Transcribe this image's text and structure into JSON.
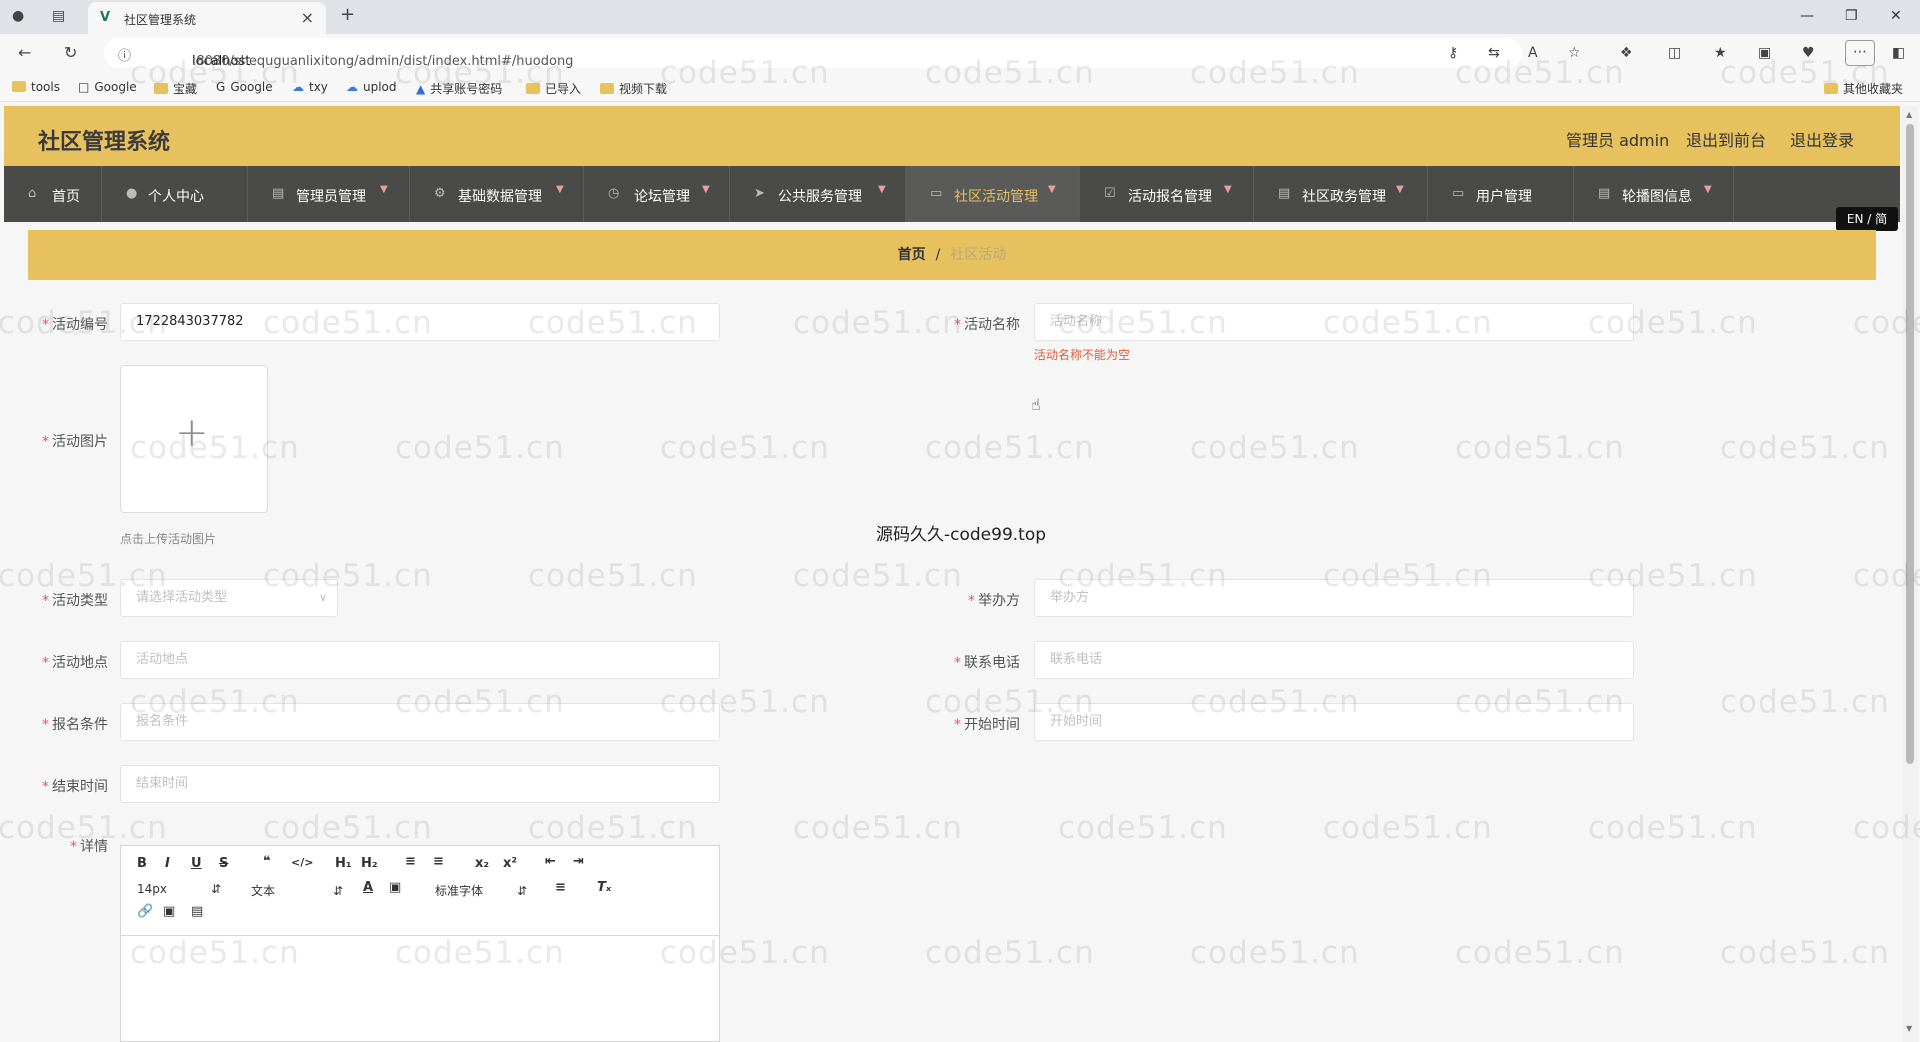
{
  "browser": {
    "tab_title": "社区管理系统",
    "url_host": "localhost",
    "url_rest": ":8080/shequguanlixitong/admin/dist/index.html#/huodong",
    "bookmarks": [
      "tools",
      "Google",
      "宝藏",
      "Google",
      "txy",
      "uplod",
      "共享账号密码",
      "已导入",
      "视频下载"
    ],
    "other_bookmarks": "其他收藏夹"
  },
  "header": {
    "title": "社区管理系统",
    "user": "管理员 admin",
    "to_front": "退出到前台",
    "logout": "退出登录"
  },
  "nav": [
    {
      "label": "首页",
      "icon": "home-icon"
    },
    {
      "label": "个人中心",
      "icon": "user-icon"
    },
    {
      "label": "管理员管理",
      "icon": "doc-icon"
    },
    {
      "label": "基础数据管理",
      "icon": "gear-icon"
    },
    {
      "label": "论坛管理",
      "icon": "clock-icon"
    },
    {
      "label": "公共服务管理",
      "icon": "send-icon"
    },
    {
      "label": "社区活动管理",
      "icon": "card-icon"
    },
    {
      "label": "活动报名管理",
      "icon": "check-icon"
    },
    {
      "label": "社区政务管理",
      "icon": "doc-icon"
    },
    {
      "label": "用户管理",
      "icon": "monitor-icon"
    },
    {
      "label": "轮播图信息",
      "icon": "image-icon"
    }
  ],
  "lang_switch": "EN / 简",
  "breadcrumb": {
    "home": "首页",
    "sep": "/",
    "current": "社区活动"
  },
  "form": {
    "activity_no": {
      "label": "活动编号",
      "value": "1722843037782"
    },
    "activity_name": {
      "label": "活动名称",
      "placeholder": "活动名称",
      "error": "活动名称不能为空"
    },
    "activity_image": {
      "label": "活动图片",
      "hint": "点击上传活动图片"
    },
    "activity_type": {
      "label": "活动类型",
      "placeholder": "请选择活动类型"
    },
    "organizer": {
      "label": "举办方",
      "placeholder": "举办方"
    },
    "location": {
      "label": "活动地点",
      "placeholder": "活动地点"
    },
    "phone": {
      "label": "联系电话",
      "placeholder": "联系电话"
    },
    "requirement": {
      "label": "报名条件",
      "placeholder": "报名条件"
    },
    "start_time": {
      "label": "开始时间",
      "placeholder": "开始时间"
    },
    "end_time": {
      "label": "结束时间",
      "placeholder": "结束时间"
    },
    "details": {
      "label": "详情"
    }
  },
  "editor": {
    "font_size": "14px",
    "block_type": "文本",
    "font_family": "标准字体"
  },
  "overlay_text": "源码久久-code99.top",
  "watermark": "code51.cn"
}
